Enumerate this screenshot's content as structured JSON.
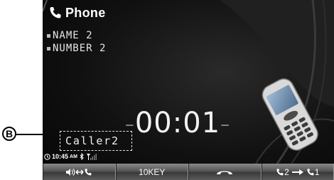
{
  "callout": {
    "label": "B"
  },
  "header": {
    "title": "Phone",
    "icon": "phone-icon"
  },
  "contact": {
    "name": "NAME 2",
    "number": "NUMBER 2"
  },
  "call": {
    "timer": "00:01",
    "caller": "Caller2"
  },
  "status": {
    "time": "10:45",
    "ampm": "AM",
    "icons": [
      "clock-icon",
      "bluetooth-icon",
      "signal-icon"
    ]
  },
  "softkeys": [
    {
      "id": "audio-transfer",
      "icons": [
        "speaker-icon",
        "swap-arrows-icon",
        "phone-icon"
      ]
    },
    {
      "id": "keypad",
      "label": "10KEY"
    },
    {
      "id": "hang-up",
      "icons": [
        "hang-up-icon"
      ]
    },
    {
      "id": "switch-line",
      "from": "2",
      "to": "1",
      "icons": [
        "phone-icon",
        "arrow-right-icon",
        "phone-icon"
      ]
    }
  ],
  "colors": {
    "background": "#0d0d0d",
    "text": "#ffffff",
    "softkey": "#5a5a5a"
  }
}
